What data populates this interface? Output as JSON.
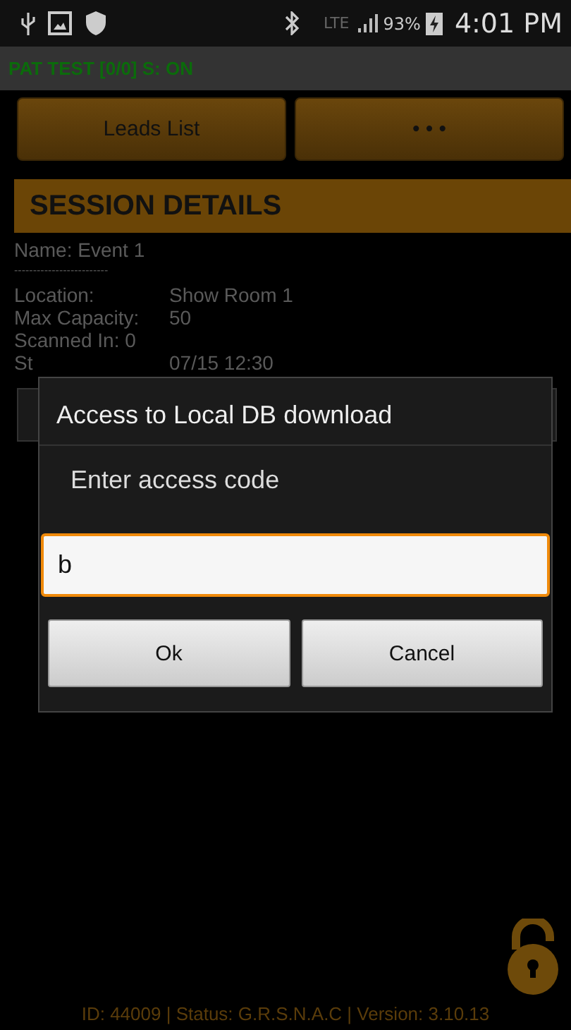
{
  "status_bar": {
    "battery": "93%",
    "network": "LTE",
    "time": "4:01 PM"
  },
  "app_bar": {
    "title": "PAT TEST [0/0] S: ON"
  },
  "buttons": [
    {
      "label": "Leads List"
    },
    {
      "label": "• • •"
    }
  ],
  "session": {
    "heading": "SESSION DETAILS",
    "name": "Name: Event 1",
    "separator": "-------------------------",
    "fields": [
      {
        "label": "Location:",
        "value": "Show Room 1"
      },
      {
        "label": "Max Capacity:",
        "value": "50"
      },
      {
        "label": "Scanned In: 0"
      },
      {
        "label": "St",
        "value": "07/15 12:30"
      }
    ]
  },
  "dialog": {
    "title": "Access to Local DB download",
    "message": "Enter access code",
    "value": "b",
    "buttons": [
      {
        "label": "Ok"
      },
      {
        "label": "Cancel"
      }
    ]
  },
  "footer": "ID: 44009 | Status: G.R.S.N.A.C | Version: 3.10.13"
}
